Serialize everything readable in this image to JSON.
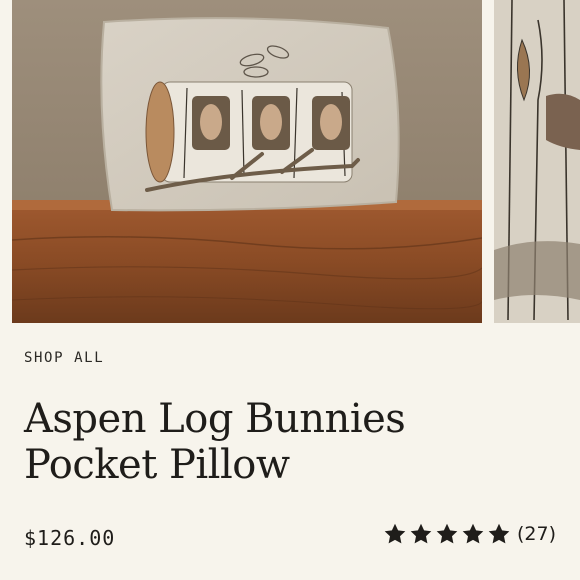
{
  "breadcrumb": {
    "shop_all": "SHOP ALL"
  },
  "product": {
    "title_line1": "Aspen Log Bunnies",
    "title_line2": "Pocket Pillow",
    "price": "$126.00"
  },
  "rating": {
    "stars": 5,
    "max": 5,
    "count": "(27)"
  },
  "colors": {
    "background": "#f7f4ec",
    "text": "#1f1d1a"
  }
}
